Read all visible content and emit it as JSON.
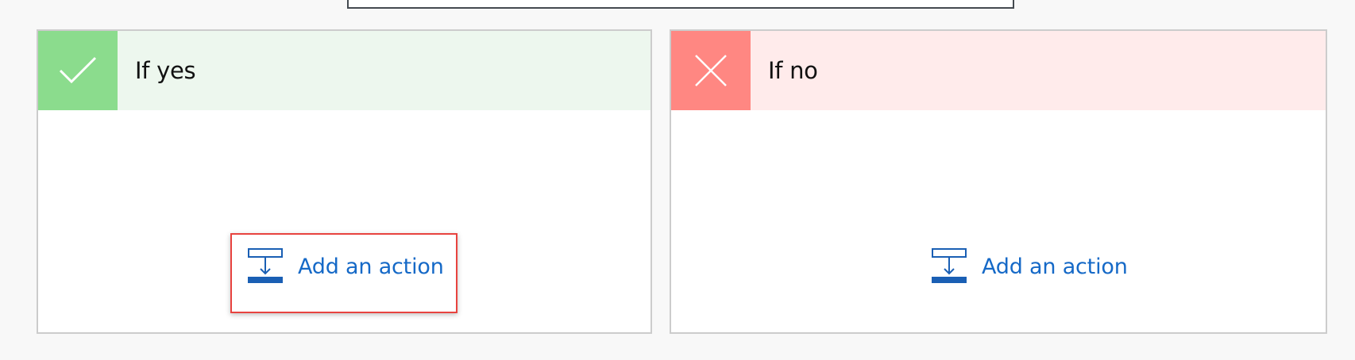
{
  "branches": {
    "yes": {
      "title": "If yes",
      "header_icon": "checkmark-icon",
      "accent_color": "#8bdc8d",
      "header_background": "#edf7ee",
      "add_action_label": "Add an action",
      "add_action_icon": "add-action-icon"
    },
    "no": {
      "title": "If no",
      "header_icon": "close-icon",
      "accent_color": "#ff8782",
      "header_background": "#ffebeb",
      "add_action_label": "Add an action",
      "add_action_icon": "add-action-icon"
    }
  },
  "colors": {
    "link": "#1569c7",
    "highlight": "#e8433f",
    "card_border": "#cccccc"
  }
}
